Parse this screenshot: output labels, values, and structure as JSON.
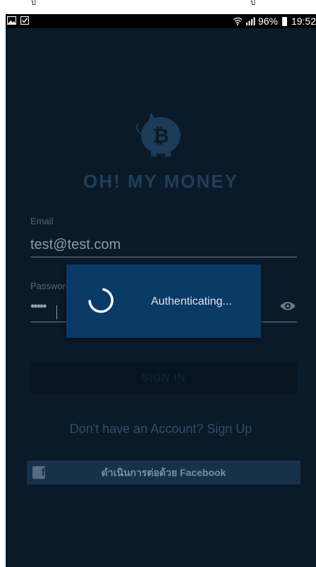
{
  "top_strip": {
    "mark_left": "ป",
    "mark_right": "ป"
  },
  "status_bar": {
    "battery_percent": "96%",
    "time": "19:52",
    "icons_left": [
      "image-icon",
      "checkbox-icon"
    ],
    "icons_right": [
      "wifi-icon",
      "signal-icon",
      "battery-icon"
    ]
  },
  "app": {
    "title": "OH! MY MONEY",
    "logo_icon": "piggy-bank-bitcoin-icon"
  },
  "form": {
    "email": {
      "label": "Email",
      "value": "test@test.com"
    },
    "password": {
      "label": "Password",
      "value": "•••••",
      "toggle_icon": "eye-icon"
    },
    "sign_in_label": "SIGN IN",
    "signup_prompt": "Don't have an Account? Sign Up"
  },
  "facebook": {
    "label": "ดำเนินการต่อด้วย Facebook",
    "icon": "facebook-icon"
  },
  "dialog": {
    "message": "Authenticating..."
  },
  "colors": {
    "background": "#0a1a28",
    "dialog": "#0a3a66",
    "title": "#1f3f5a",
    "facebook": "#17314a"
  }
}
